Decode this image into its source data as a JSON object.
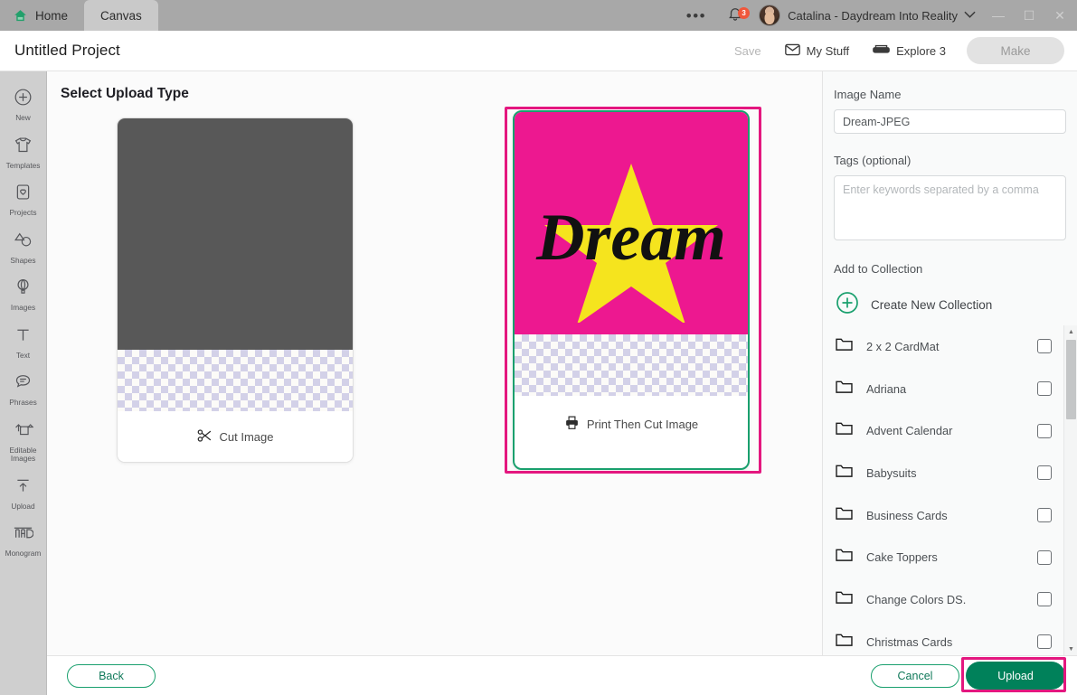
{
  "titlebar": {
    "tabs": [
      {
        "label": "Home",
        "icon": "home-icon",
        "active": false
      },
      {
        "label": "Canvas",
        "icon": "",
        "active": true
      }
    ],
    "overflow_icon": "ellipsis-icon",
    "notification_icon": "bell-icon",
    "notification_count": "3",
    "account_name": "Catalina - Daydream Into Reality",
    "account_chevron": "chevron-down-icon",
    "window_minimize": "—",
    "window_maximize": "☐",
    "window_close": "✕"
  },
  "project_header": {
    "title": "Untitled Project",
    "save_label": "Save",
    "my_stuff_label": "My Stuff",
    "explore_label": "Explore 3",
    "make_label": "Make"
  },
  "sidebar": {
    "items": [
      {
        "label": "New",
        "icon": "plus-circle-icon"
      },
      {
        "label": "Templates",
        "icon": "tshirt-icon"
      },
      {
        "label": "Projects",
        "icon": "clipboard-heart-icon"
      },
      {
        "label": "Shapes",
        "icon": "shapes-icon"
      },
      {
        "label": "Images",
        "icon": "hot-air-balloon-icon"
      },
      {
        "label": "Text",
        "icon": "text-t-icon"
      },
      {
        "label": "Phrases",
        "icon": "speech-bubble-icon"
      },
      {
        "label": "Editable Images",
        "icon": "editable-images-icon"
      },
      {
        "label": "Upload",
        "icon": "upload-arrow-icon"
      },
      {
        "label": "Monogram",
        "icon": "monogram-icon"
      }
    ]
  },
  "main": {
    "title": "Select Upload Type",
    "cards": [
      {
        "id": "cut",
        "label": "Cut Image",
        "icon": "scissors-icon",
        "selected": false,
        "preview_color": "#585858"
      },
      {
        "id": "print-then-cut",
        "label": "Print Then Cut Image",
        "icon": "printer-icon",
        "selected": true,
        "preview_color": "#ed1890",
        "artwork_text": "Dream",
        "artwork_star_color": "#f5e41e",
        "artwork_text_color": "#111111"
      }
    ],
    "selection_highlight_color": "#e4177f",
    "selected_border_color": "#1aa06e"
  },
  "panel": {
    "image_name_label": "Image Name",
    "image_name_value": "Dream-JPEG",
    "tags_label": "Tags (optional)",
    "tags_value": "",
    "tags_placeholder": "Enter keywords separated by a comma",
    "add_to_collection_label": "Add to Collection",
    "create_new_collection_label": "Create New Collection",
    "create_new_collection_icon": "plus-circle-icon",
    "collections": [
      {
        "name": "2 x 2 CardMat",
        "checked": false
      },
      {
        "name": "Adriana",
        "checked": false
      },
      {
        "name": "Advent Calendar",
        "checked": false
      },
      {
        "name": "Babysuits",
        "checked": false
      },
      {
        "name": "Business Cards",
        "checked": false
      },
      {
        "name": "Cake Toppers",
        "checked": false
      },
      {
        "name": "Change Colors DS.",
        "checked": false
      },
      {
        "name": "Christmas Cards",
        "checked": false
      }
    ],
    "scroll_up_icon": "caret-up-icon",
    "scroll_down_icon": "caret-down-icon"
  },
  "bottombar": {
    "back_label": "Back",
    "cancel_label": "Cancel",
    "upload_label": "Upload",
    "upload_highlight_color": "#e4177f",
    "upload_button_color": "#00815a"
  }
}
